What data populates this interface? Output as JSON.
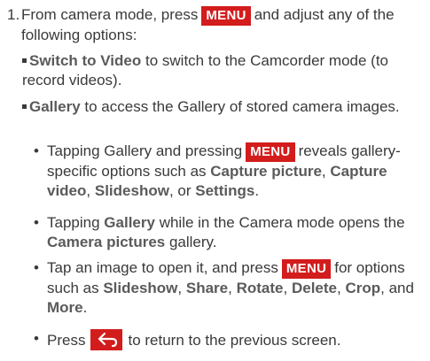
{
  "step": {
    "number": "1.",
    "text_a": "From camera mode, press",
    "menu_key": "MENU",
    "text_b": "and adjust any of the following options:"
  },
  "switch_to_video": {
    "term": "Switch to Video",
    "text": "to switch to the Camcorder mode (to record videos)."
  },
  "gallery": {
    "term": "Gallery",
    "text": "to access the Gallery of stored camera images."
  },
  "bullets": {
    "b1": {
      "text_a": "Tapping Gallery and pressing",
      "menu_key": "MENU",
      "text_b": "reveals gallery-specific options such as",
      "opt1": "Capture picture",
      "sep1": ",",
      "opt2": "Capture video",
      "sep2": ",",
      "opt3": "Slideshow",
      "sep3": ", or",
      "opt4": "Settings",
      "end": "."
    },
    "b2": {
      "text_a": "Tapping",
      "term": "Gallery",
      "text_b": "while in the Camera mode opens the",
      "term2": "Camera pictures",
      "text_c": "gallery."
    },
    "b3": {
      "text_a": "Tap an image to open it, and press",
      "menu_key": "MENU",
      "text_b": "for options such as",
      "opt1": "Slideshow",
      "sep1": ",",
      "opt2": "Share",
      "sep2": ",",
      "opt3": "Rotate",
      "sep3": ",",
      "opt4": "Delete",
      "sep4": ",",
      "opt5": "Crop",
      "sep5": ", and",
      "opt6": "More",
      "end": "."
    },
    "b4": {
      "text_a": "Press",
      "key_icon": "back-arrow-icon",
      "text_b": "to return to the previous screen."
    }
  },
  "colors": {
    "key_bg": "#d31c1c",
    "text": "#3a3a3a",
    "highlight": "#5a5a5a"
  }
}
